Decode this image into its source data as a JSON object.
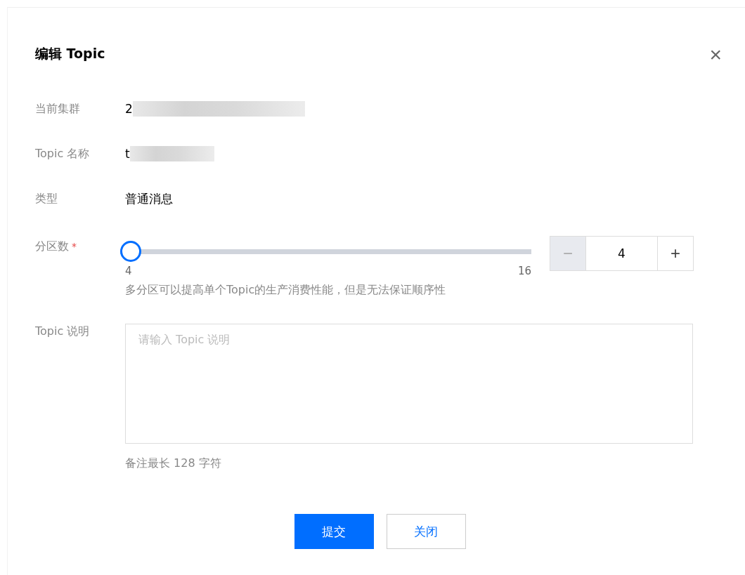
{
  "dialog": {
    "title": "编辑 Topic",
    "close": "×"
  },
  "fields": [
    {
      "kind": "text",
      "label": "当前集群",
      "value": "2",
      "redacted": true
    },
    {
      "kind": "text",
      "label": "Topic 名称",
      "value": "t",
      "redacted": true
    },
    {
      "kind": "text",
      "label": "类型",
      "value": "普通消息"
    },
    {
      "kind": "slider",
      "label": "分区数",
      "required_mark": "*",
      "level": 0,
      "min_label": "4",
      "max_label": "16",
      "minus": "−",
      "plus": "+",
      "minus_disabled": true,
      "value": "4",
      "hint": "多分区可以提高单个Topic的生产消费性能，但是无法保证顺序性"
    },
    {
      "kind": "textarea",
      "label": "Topic 说明",
      "placeholder": "请输入 Topic 说明",
      "note": "备注最长 128 字符"
    }
  ],
  "buttons": [
    {
      "label": "提交",
      "primary": true
    },
    {
      "label": "关闭",
      "primary": false
    }
  ]
}
